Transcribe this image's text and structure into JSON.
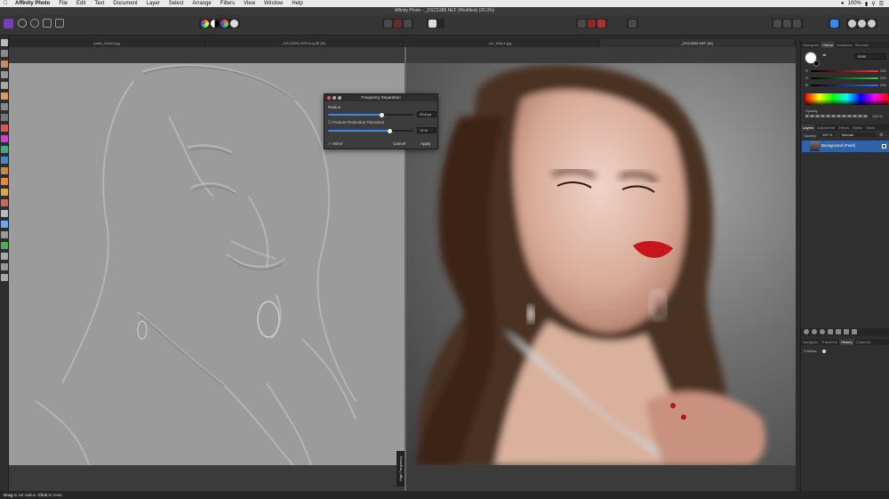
{
  "menubar": {
    "app_name": "Affinity Photo",
    "items": [
      "File",
      "Edit",
      "Text",
      "Document",
      "Layer",
      "Select",
      "Arrange",
      "Filters",
      "View",
      "Window",
      "Help"
    ],
    "zoom_status": "100%"
  },
  "window": {
    "title": "Affinity Photo - _DSC5388.NEF (Modified) (20.3%)"
  },
  "doc_tabs": [
    {
      "label": "paths_before.jpg",
      "active": false
    },
    {
      "label": "_DSC8095-HDR.tiog.tiff (M)",
      "active": false
    },
    {
      "label": "cer_before.jpg",
      "active": false
    },
    {
      "label": "_DSC5388.NEF (M)",
      "active": true
    }
  ],
  "dialog": {
    "title": "Frequency Separation",
    "radius_label": "Radius",
    "radius_value": "23.8 px",
    "radius_fraction": 0.63,
    "tolerance_label": "Feature Protection Tolerance",
    "tolerance_value": "72 %",
    "tolerance_fraction": 0.72,
    "mirror_label": "Mirror",
    "mirror_checked": true,
    "cancel_label": "Cancel",
    "apply_label": "Apply"
  },
  "canvas": {
    "split_label": "High Frequency"
  },
  "panels": {
    "color_tabs": [
      "Histogram",
      "Colour",
      "Swatches",
      "Brushes"
    ],
    "color_active_tab": "Colour",
    "color_model": "RGB",
    "channels": [
      {
        "label": "R",
        "value": "255",
        "color": "#e04040"
      },
      {
        "label": "G",
        "value": "255",
        "color": "#40c040"
      },
      {
        "label": "B",
        "value": "255",
        "color": "#5070e0"
      }
    ],
    "opacity_label": "Opacity",
    "opacity_value": "100 %",
    "layer_tabs": [
      "Layers",
      "Adjustment",
      "Effects",
      "Styles",
      "Stock"
    ],
    "layer_active_tab": "Layers",
    "layer_opacity_label": "Opacity:",
    "layer_opacity_value": "100 %",
    "blend_mode": "Normal",
    "layers": [
      {
        "name": "Background (Pixel)",
        "selected": true
      }
    ],
    "history_tabs": [
      "Navigator",
      "Transform",
      "History",
      "Channels"
    ],
    "history_active_tab": "History",
    "history_position_label": "Position:"
  },
  "statusbar": {
    "text_bold1": "Drag",
    "text1": " to set radius. ",
    "text_bold2": "Click",
    "text2": " to reset."
  },
  "colors": {
    "accent": "#3c88e6",
    "selection": "#2f62a6",
    "lips": "#c8141e"
  }
}
